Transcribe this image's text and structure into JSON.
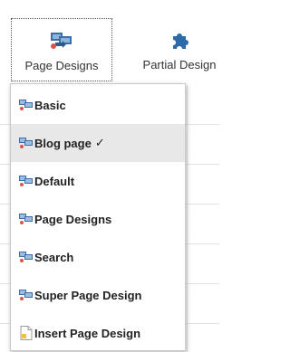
{
  "ribbon": {
    "buttons": [
      {
        "label": "Page Designs",
        "icon": "page-designs-icon",
        "active": true
      },
      {
        "label": "Partial Design",
        "icon": "puzzle-piece-icon",
        "active": false
      }
    ]
  },
  "dropdown": {
    "items": [
      {
        "label": "Basic",
        "icon": "page-design-icon",
        "selected": false,
        "check": ""
      },
      {
        "label": "Blog page",
        "icon": "page-design-icon",
        "selected": true,
        "check": "✓"
      },
      {
        "label": "Default",
        "icon": "page-design-icon",
        "selected": false,
        "check": ""
      },
      {
        "label": "Page Designs",
        "icon": "page-design-icon",
        "selected": false,
        "check": ""
      },
      {
        "label": "Search",
        "icon": "page-design-icon",
        "selected": false,
        "check": ""
      },
      {
        "label": "Super Page Design",
        "icon": "page-design-icon",
        "selected": false,
        "check": ""
      },
      {
        "label": "Insert Page Design",
        "icon": "new-page-icon",
        "selected": false,
        "check": ""
      }
    ]
  },
  "colors": {
    "icon_blue": "#3a6ea5",
    "icon_red": "#d9534f",
    "selected_bg": "#e8e8e8"
  }
}
